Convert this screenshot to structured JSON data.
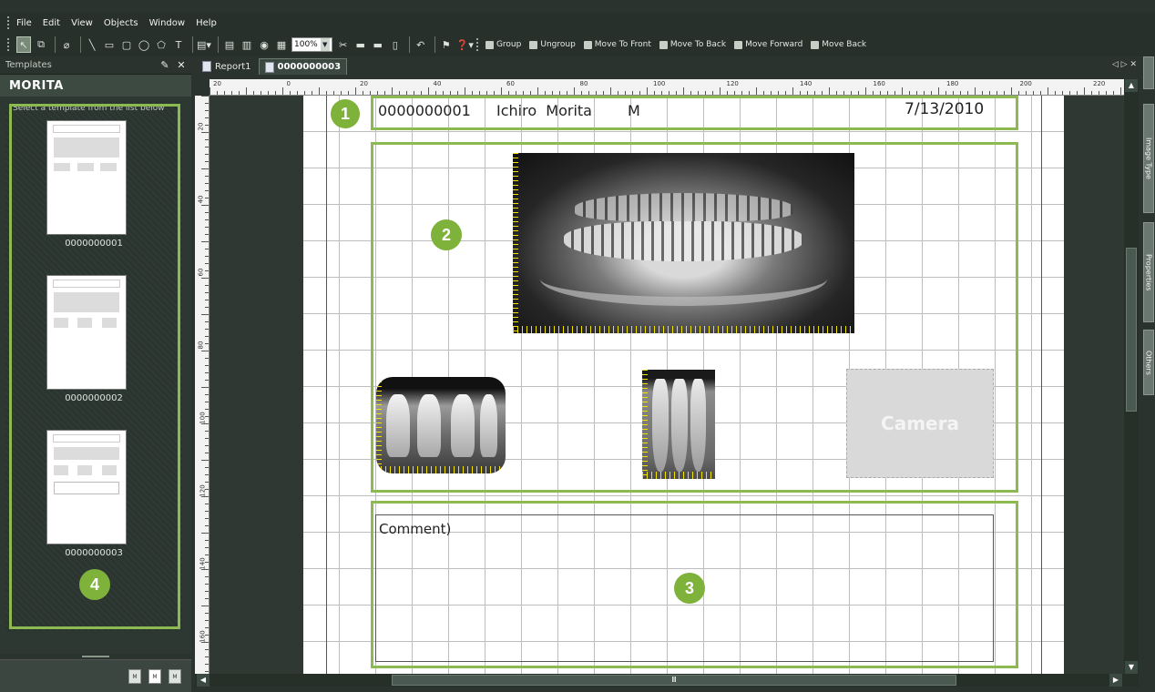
{
  "menu": [
    "File",
    "Edit",
    "View",
    "Objects",
    "Window",
    "Help"
  ],
  "toolbar": {
    "zoom": "100%",
    "commands": [
      "Group",
      "Ungroup",
      "Move To Front",
      "Move To Back",
      "Move Forward",
      "Move Back"
    ]
  },
  "templates_panel": {
    "header": "Templates",
    "title": "MORITA",
    "hint": "Select a template from the list below",
    "items": [
      "0000000001",
      "0000000002",
      "0000000003"
    ]
  },
  "tabs": [
    "Report1",
    "0000000003"
  ],
  "ruler": {
    "top": [
      "20",
      "0",
      "20",
      "40",
      "60",
      "80",
      "100",
      "120",
      "140",
      "160",
      "180",
      "200",
      "220"
    ],
    "left": [
      "20",
      "40",
      "60",
      "80",
      "100",
      "120",
      "140",
      "160"
    ]
  },
  "report": {
    "patient_id": "0000000001",
    "patient_name": "Ichiro  Morita",
    "sex": "M",
    "date": "7/13/2010",
    "camera_label": "Camera",
    "comment_label": "Comment)"
  },
  "callouts": [
    "1",
    "2",
    "3",
    "4"
  ],
  "right_tabs": [
    "Image Type",
    "Properties",
    "Others"
  ],
  "colors": {
    "accent_green": "#8dba50",
    "badge_green": "#7fb23a"
  }
}
